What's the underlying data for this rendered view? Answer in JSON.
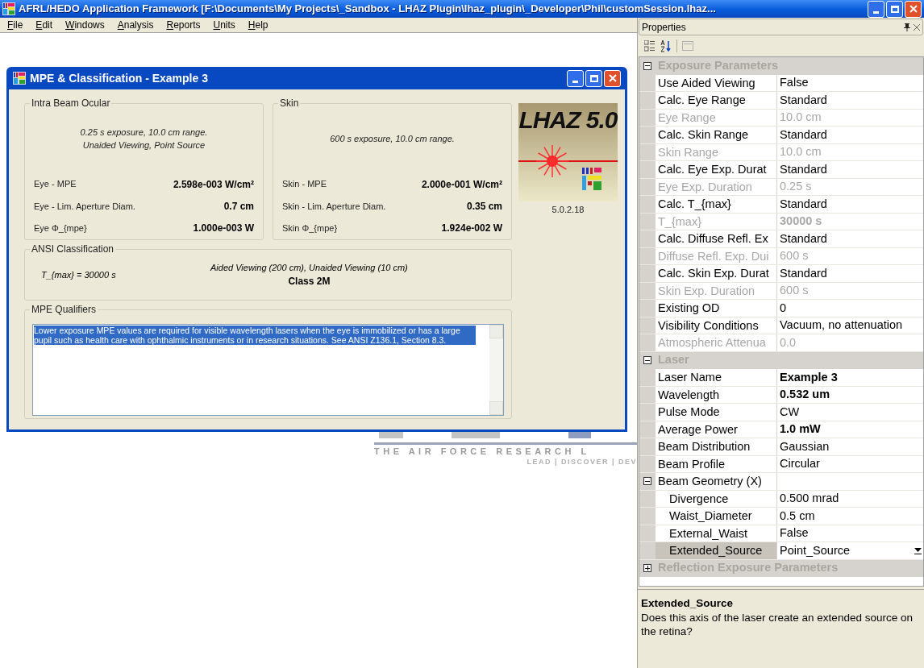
{
  "window": {
    "title": "AFRL/HEDO Application Framework [F:\\Documents\\My Projects\\_Sandbox - LHAZ Plugin\\lhaz_plugin\\_Developer\\Phil\\customSession.lhaz..."
  },
  "menu": [
    {
      "label": "File"
    },
    {
      "label": "Edit"
    },
    {
      "label": "Windows"
    },
    {
      "label": "Analysis"
    },
    {
      "label": "Reports"
    },
    {
      "label": "Units"
    },
    {
      "label": "Help"
    }
  ],
  "background": {
    "tagline": "THE AIR FORCE RESEARCH L",
    "motto": "LEAD | DISCOVER | DEV"
  },
  "dialog": {
    "title": "MPE & Classification - Example 3",
    "groups": [
      {
        "title": "Intra Beam Ocular",
        "description": [
          "0.25 s exposure, 10.0 cm range.",
          "Unaided Viewing, Point Source"
        ],
        "rows": [
          {
            "label": "Eye - MPE",
            "value": "2.598e-003 W/cm²"
          },
          {
            "label": "Eye - Lim. Aperture Diam.",
            "value": "0.7 cm"
          },
          {
            "label": "Eye Φ_{mpe}",
            "value": "1.000e-003 W"
          }
        ]
      },
      {
        "title": "Skin",
        "description": [
          "600 s exposure, 10.0 cm range."
        ],
        "rows": [
          {
            "label": "Skin - MPE",
            "value": "2.000e-001 W/cm²"
          },
          {
            "label": "Skin - Lim. Aperture Diam.",
            "value": "0.35 cm"
          },
          {
            "label": "Skin Φ_{mpe}",
            "value": "1.924e-002 W"
          }
        ]
      }
    ],
    "logo": {
      "title": "LHAZ 5.0",
      "version": "5.0.2.18"
    },
    "ansi": {
      "title": "ANSI Classification",
      "tmax": "T_{max} = 30000 s",
      "viewing": "Aided Viewing (200 cm), Unaided Viewing (10 cm)",
      "class": "Class 2M"
    },
    "qualifiers": {
      "title": "MPE Qualifiers",
      "text": "Lower exposure MPE values are required for visible wavelength lasers when the eye is immobilized or has a large pupil such as health care with ophthalmic instruments or in research situations.  See ANSI Z136.1, Section 8.3.",
      "selected": true
    }
  },
  "properties": {
    "title": "Properties",
    "categories": [
      {
        "name": "Exposure Parameters",
        "expanded": true,
        "items": [
          {
            "name": "Use Aided Viewing",
            "value": "False",
            "disabled": false,
            "bold": false,
            "selected": false
          },
          {
            "name": "Calc. Eye Range",
            "value": "Standard",
            "disabled": false,
            "bold": false,
            "selected": false
          },
          {
            "name": "Eye Range",
            "value": "10.0 cm",
            "disabled": true,
            "bold": false,
            "selected": false
          },
          {
            "name": "Calc. Skin Range",
            "value": "Standard",
            "disabled": false,
            "bold": false,
            "selected": false
          },
          {
            "name": "Skin Range",
            "value": "10.0 cm",
            "disabled": true,
            "bold": false,
            "selected": false
          },
          {
            "name": "Calc. Eye Exp. Durat",
            "value": "Standard",
            "disabled": false,
            "bold": false,
            "selected": false
          },
          {
            "name": "Eye Exp. Duration",
            "value": "0.25 s",
            "disabled": true,
            "bold": false,
            "selected": false
          },
          {
            "name": "Calc. T_{max}",
            "value": "Standard",
            "disabled": false,
            "bold": false,
            "selected": false
          },
          {
            "name": "T_{max}",
            "value": "30000 s",
            "disabled": true,
            "bold": true,
            "selected": false
          },
          {
            "name": "Calc. Diffuse Refl. Ex",
            "value": "Standard",
            "disabled": false,
            "bold": false,
            "selected": false
          },
          {
            "name": "Diffuse Refl. Exp. Dui",
            "value": "600 s",
            "disabled": true,
            "bold": false,
            "selected": false
          },
          {
            "name": "Calc. Skin Exp. Durat",
            "value": "Standard",
            "disabled": false,
            "bold": false,
            "selected": false
          },
          {
            "name": "Skin Exp. Duration",
            "value": "600 s",
            "disabled": true,
            "bold": false,
            "selected": false
          },
          {
            "name": "Existing OD",
            "value": "0",
            "disabled": false,
            "bold": false,
            "selected": false
          },
          {
            "name": "Visibility Conditions",
            "value": "Vacuum, no attenuation",
            "disabled": false,
            "bold": false,
            "selected": false
          },
          {
            "name": "Atmospheric Attenua",
            "value": "0.0",
            "disabled": true,
            "bold": false,
            "selected": false
          }
        ]
      },
      {
        "name": "Laser",
        "expanded": true,
        "items": [
          {
            "name": "Laser Name",
            "value": "Example 3",
            "disabled": false,
            "bold": true,
            "selected": false
          },
          {
            "name": "Wavelength",
            "value": "0.532 um",
            "disabled": false,
            "bold": true,
            "selected": false
          },
          {
            "name": "Pulse Mode",
            "value": "CW",
            "disabled": false,
            "bold": false,
            "selected": false
          },
          {
            "name": "Average Power",
            "value": "1.0 mW",
            "disabled": false,
            "bold": true,
            "selected": false
          },
          {
            "name": "Beam Distribution",
            "value": "Gaussian",
            "disabled": false,
            "bold": false,
            "selected": false
          },
          {
            "name": "Beam Profile",
            "value": "Circular",
            "disabled": false,
            "bold": false,
            "selected": false
          },
          {
            "name": "Beam Geometry (X)",
            "expanded": true,
            "disabled": false,
            "selected": false,
            "children": [
              {
                "name": "Divergence",
                "value": "0.500 mrad",
                "disabled": false,
                "bold": false,
                "selected": false
              },
              {
                "name": "Waist_Diameter",
                "value": "0.5 cm",
                "disabled": false,
                "bold": false,
                "selected": false
              },
              {
                "name": "External_Waist",
                "value": "False",
                "disabled": false,
                "bold": false,
                "selected": false
              },
              {
                "name": "Extended_Source",
                "value": "Point_Source",
                "disabled": false,
                "bold": false,
                "selected": true
              }
            ]
          }
        ]
      },
      {
        "name": "Reflection Exposure Parameters",
        "expanded": false
      }
    ],
    "description": {
      "title": "Extended_Source",
      "text": "Does this axis of the laser create an extended source on the retina?"
    }
  }
}
